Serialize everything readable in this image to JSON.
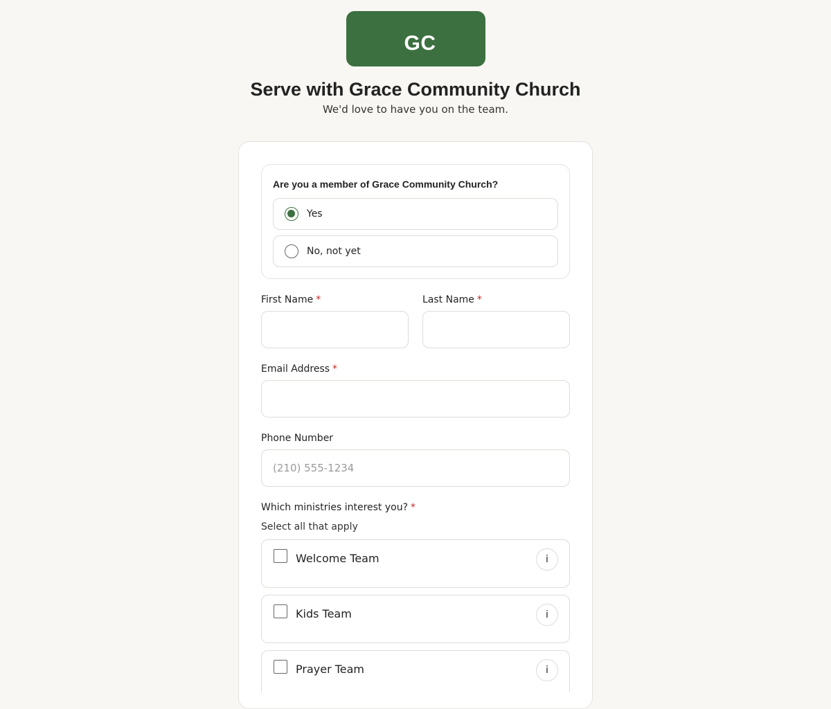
{
  "logo": {
    "initials": "GC",
    "color": "#3d7040"
  },
  "header": {
    "title": "Serve with Grace Community Church",
    "subtitle": "We'd love to have you on the team."
  },
  "membership": {
    "question": "Are you a member of Grace Community Church?",
    "options": [
      {
        "label": "Yes",
        "selected": true
      },
      {
        "label": "No, not yet",
        "selected": false
      }
    ]
  },
  "form": {
    "required_marker": "*",
    "first_name": {
      "label": "First Name",
      "value": ""
    },
    "last_name": {
      "label": "Last Name",
      "value": ""
    },
    "email": {
      "label": "Email Address",
      "value": ""
    },
    "phone": {
      "label": "Phone Number",
      "value": "",
      "placeholder": "(210) 555-1234"
    }
  },
  "ministries": {
    "label": "Which ministries interest you?",
    "help": "Select all that apply",
    "info_icon": "i",
    "options": [
      {
        "label": "Welcome Team",
        "checked": false
      },
      {
        "label": "Kids Team",
        "checked": false
      },
      {
        "label": "Prayer Team",
        "checked": false
      }
    ]
  },
  "colors": {
    "accent": "#3d7040",
    "required": "#c62828",
    "background": "#f8f7f3"
  }
}
